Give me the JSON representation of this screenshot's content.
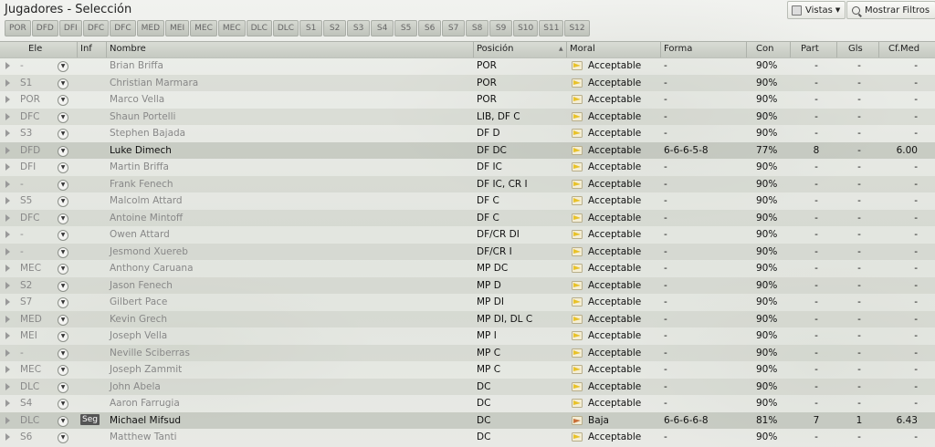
{
  "title": "Jugadores - Selección",
  "toolbar": {
    "vistas_label": "Vistas",
    "filtros_label": "Mostrar Filtros"
  },
  "tabs": [
    "POR",
    "DFD",
    "DFI",
    "DFC",
    "DFC",
    "MED",
    "MEI",
    "MEC",
    "MEC",
    "DLC",
    "DLC",
    "S1",
    "S2",
    "S3",
    "S4",
    "S5",
    "S6",
    "S7",
    "S8",
    "S9",
    "S10",
    "S11",
    "S12"
  ],
  "columns": {
    "ele": "Ele",
    "inf": "Inf",
    "nombre": "Nombre",
    "posicion": "Posición",
    "moral": "Moral",
    "forma": "Forma",
    "con": "Con",
    "part": "Part",
    "gls": "Gls",
    "cfmed": "Cf.Med"
  },
  "players": [
    {
      "ele": "-",
      "name": "Brian Briffa",
      "pos": "POR",
      "moral": "Acceptable",
      "forma": "-",
      "con": "90%",
      "part": "-",
      "gls": "-",
      "cf": "-",
      "mood": "ok"
    },
    {
      "ele": "S1",
      "name": "Christian Marmara",
      "pos": "POR",
      "moral": "Acceptable",
      "forma": "-",
      "con": "90%",
      "part": "-",
      "gls": "-",
      "cf": "-",
      "mood": "ok"
    },
    {
      "ele": "POR",
      "name": "Marco Vella",
      "pos": "POR",
      "moral": "Acceptable",
      "forma": "-",
      "con": "90%",
      "part": "-",
      "gls": "-",
      "cf": "-",
      "mood": "ok"
    },
    {
      "ele": "DFC",
      "name": "Shaun Portelli",
      "pos": "LIB, DF C",
      "moral": "Acceptable",
      "forma": "-",
      "con": "90%",
      "part": "-",
      "gls": "-",
      "cf": "-",
      "mood": "ok"
    },
    {
      "ele": "S3",
      "name": "Stephen Bajada",
      "pos": "DF D",
      "moral": "Acceptable",
      "forma": "-",
      "con": "90%",
      "part": "-",
      "gls": "-",
      "cf": "-",
      "mood": "ok"
    },
    {
      "ele": "DFD",
      "name": "Luke Dimech",
      "pos": "DF DC",
      "moral": "Acceptable",
      "forma": "6-6-6-5-8",
      "con": "77%",
      "part": "8",
      "gls": "-",
      "cf": "6.00",
      "mood": "ok",
      "hi": true
    },
    {
      "ele": "DFI",
      "name": "Martin Briffa",
      "pos": "DF IC",
      "moral": "Acceptable",
      "forma": "-",
      "con": "90%",
      "part": "-",
      "gls": "-",
      "cf": "-",
      "mood": "ok"
    },
    {
      "ele": "-",
      "name": "Frank Fenech",
      "pos": "DF IC, CR I",
      "moral": "Acceptable",
      "forma": "-",
      "con": "90%",
      "part": "-",
      "gls": "-",
      "cf": "-",
      "mood": "ok"
    },
    {
      "ele": "S5",
      "name": "Malcolm Attard",
      "pos": "DF C",
      "moral": "Acceptable",
      "forma": "-",
      "con": "90%",
      "part": "-",
      "gls": "-",
      "cf": "-",
      "mood": "ok"
    },
    {
      "ele": "DFC",
      "name": "Antoine Mintoff",
      "pos": "DF C",
      "moral": "Acceptable",
      "forma": "-",
      "con": "90%",
      "part": "-",
      "gls": "-",
      "cf": "-",
      "mood": "ok"
    },
    {
      "ele": "-",
      "name": "Owen Attard",
      "pos": "DF/CR DI",
      "moral": "Acceptable",
      "forma": "-",
      "con": "90%",
      "part": "-",
      "gls": "-",
      "cf": "-",
      "mood": "ok"
    },
    {
      "ele": "-",
      "name": "Jesmond Xuereb",
      "pos": "DF/CR I",
      "moral": "Acceptable",
      "forma": "-",
      "con": "90%",
      "part": "-",
      "gls": "-",
      "cf": "-",
      "mood": "ok"
    },
    {
      "ele": "MEC",
      "name": "Anthony Caruana",
      "pos": "MP DC",
      "moral": "Acceptable",
      "forma": "-",
      "con": "90%",
      "part": "-",
      "gls": "-",
      "cf": "-",
      "mood": "ok"
    },
    {
      "ele": "S2",
      "name": "Jason Fenech",
      "pos": "MP D",
      "moral": "Acceptable",
      "forma": "-",
      "con": "90%",
      "part": "-",
      "gls": "-",
      "cf": "-",
      "mood": "ok"
    },
    {
      "ele": "S7",
      "name": "Gilbert Pace",
      "pos": "MP DI",
      "moral": "Acceptable",
      "forma": "-",
      "con": "90%",
      "part": "-",
      "gls": "-",
      "cf": "-",
      "mood": "ok"
    },
    {
      "ele": "MED",
      "name": "Kevin Grech",
      "pos": "MP DI, DL C",
      "moral": "Acceptable",
      "forma": "-",
      "con": "90%",
      "part": "-",
      "gls": "-",
      "cf": "-",
      "mood": "ok"
    },
    {
      "ele": "MEI",
      "name": "Joseph Vella",
      "pos": "MP I",
      "moral": "Acceptable",
      "forma": "-",
      "con": "90%",
      "part": "-",
      "gls": "-",
      "cf": "-",
      "mood": "ok"
    },
    {
      "ele": "-",
      "name": "Neville Sciberras",
      "pos": "MP C",
      "moral": "Acceptable",
      "forma": "-",
      "con": "90%",
      "part": "-",
      "gls": "-",
      "cf": "-",
      "mood": "ok"
    },
    {
      "ele": "MEC",
      "name": "Joseph Zammit",
      "pos": "MP C",
      "moral": "Acceptable",
      "forma": "-",
      "con": "90%",
      "part": "-",
      "gls": "-",
      "cf": "-",
      "mood": "ok"
    },
    {
      "ele": "DLC",
      "name": "John Abela",
      "pos": "DC",
      "moral": "Acceptable",
      "forma": "-",
      "con": "90%",
      "part": "-",
      "gls": "-",
      "cf": "-",
      "mood": "ok"
    },
    {
      "ele": "S4",
      "name": "Aaron Farrugia",
      "pos": "DC",
      "moral": "Acceptable",
      "forma": "-",
      "con": "90%",
      "part": "-",
      "gls": "-",
      "cf": "-",
      "mood": "ok"
    },
    {
      "ele": "DLC",
      "name": "Michael Mifsud",
      "inf": "Seg",
      "pos": "DC",
      "moral": "Baja",
      "forma": "6-6-6-6-8",
      "con": "81%",
      "part": "7",
      "gls": "1",
      "cf": "6.43",
      "mood": "low",
      "hi": true
    },
    {
      "ele": "S6",
      "name": "Matthew Tanti",
      "pos": "DC",
      "moral": "Acceptable",
      "forma": "-",
      "con": "90%",
      "part": "-",
      "gls": "-",
      "cf": "-",
      "mood": "ok"
    }
  ],
  "colors": {
    "mood_ok": "#e8c22a",
    "mood_low": "#c9713a"
  }
}
